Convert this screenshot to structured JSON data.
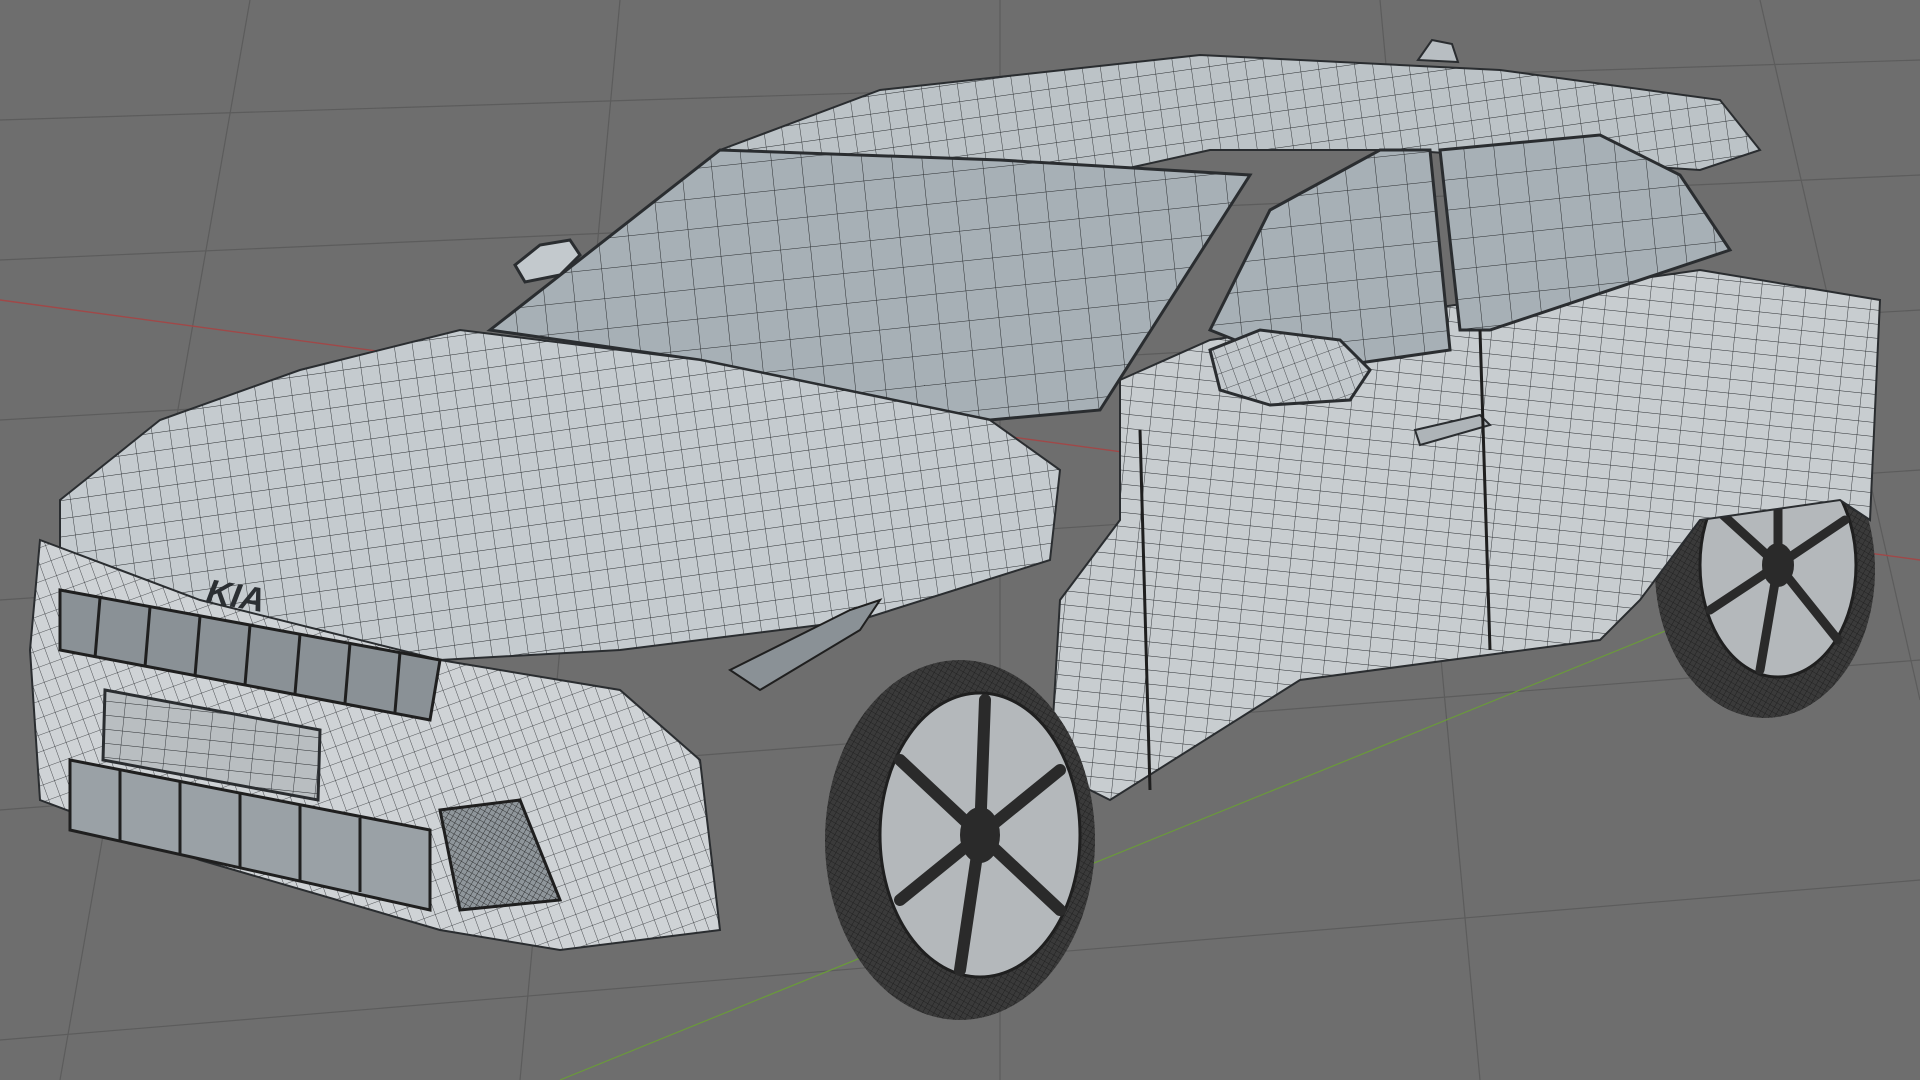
{
  "viewport": {
    "mode": "3d-wireframe-viewport",
    "background_color": "#6e6e6e",
    "grid_line_color": "#5c5c5c",
    "axis_x_color": "#a04848",
    "axis_y_color": "#6a9a3a"
  },
  "model": {
    "subject": "car-hatchback-wireframe",
    "base_color": "#c8cdd0",
    "wire_color": "#2a2d30",
    "glass_color": "#a7b0b6",
    "tire_color": "#3a3a3a",
    "brand_badge_text": "KIA"
  }
}
